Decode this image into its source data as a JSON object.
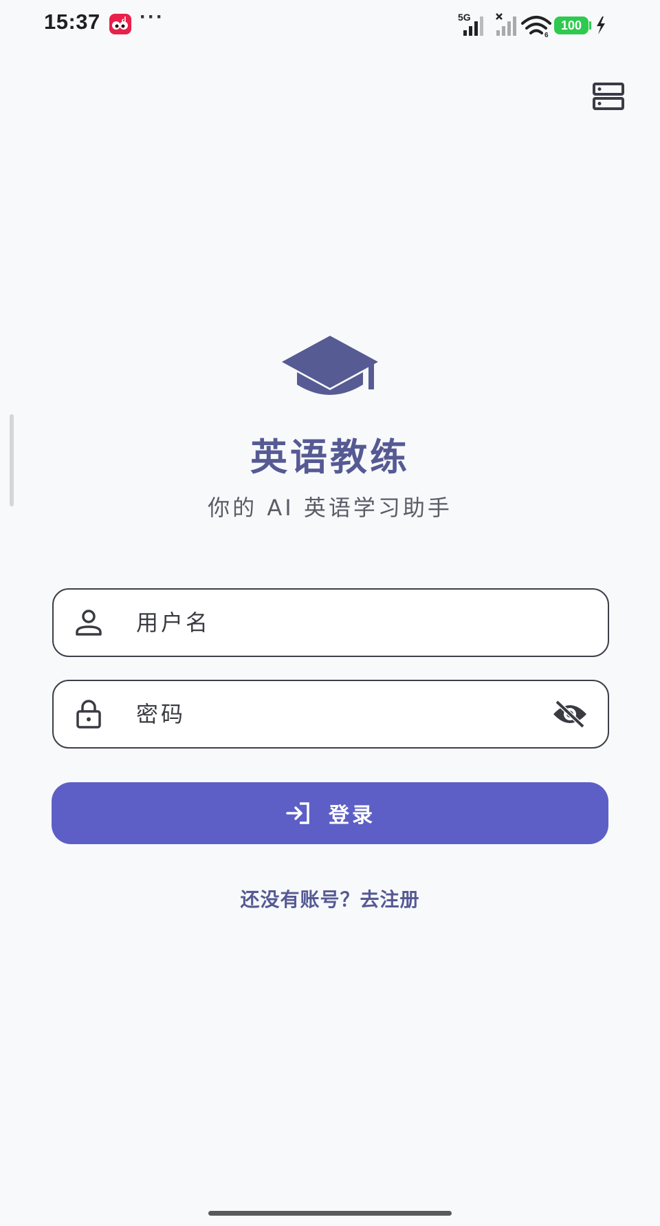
{
  "status_bar": {
    "time": "15:37",
    "more": "···",
    "network_label": "5G",
    "battery": "100",
    "wifi_badge": "6"
  },
  "icons": {
    "server": "server-icon",
    "logo": "graduation-cap-icon",
    "username": "person-icon",
    "password": "lock-icon",
    "visibility": "eye-off-icon",
    "login": "login-arrow-icon"
  },
  "app": {
    "title": "英语教练",
    "subtitle": "你的 AI 英语学习助手"
  },
  "form": {
    "username_placeholder": "用户名",
    "username_value": "",
    "password_placeholder": "密码",
    "password_value": "",
    "login_label": "登录",
    "register_link": "还没有账号？去注册"
  },
  "colors": {
    "accent": "#5d5fc6",
    "title": "#565a93",
    "background": "#f8f9fb",
    "battery": "#2ec94f"
  }
}
